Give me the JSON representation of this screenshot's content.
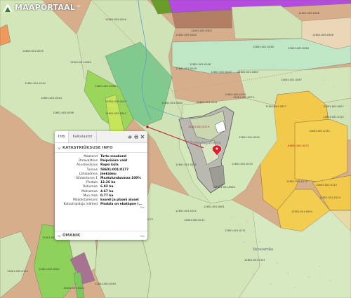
{
  "app": {
    "title": "MAAPORTAAL",
    "title_suffix": "EE"
  },
  "map": {
    "place_names": {
      "village_1": "Värske-Augumetsa",
      "village_2": "Kebasemäe"
    },
    "selected_parcel_label": "58601:001:0177",
    "parcel_labels": [
      "12601:005:0240",
      "12601:005:0286",
      "12601:005:0302",
      "12601:005:0283",
      "12601:005:0306",
      "12601:005:0284",
      "12601:001:0246",
      "12601:001:0245",
      "12601:001:0282",
      "12601:001:0140",
      "12601:001:0248",
      "12601:001:0249",
      "12601:001:0247",
      "12601:001:0080",
      "12601:001:0287",
      "12601:001:0288",
      "12601:001:0244",
      "12601:005:0243",
      "12601:005:0298",
      "12601:005:0242",
      "12601:005:0253",
      "12601:001:0079",
      "12601:001:0260",
      "12601:001:0141",
      "12601:001:0027",
      "12601:001:0057",
      "12601:001:0112",
      "12601:001:0132",
      "12601:001:0045",
      "12601:001:0125",
      "12601:001:0162",
      "12601:001:0170",
      "12601:001:0113",
      "12601:001:0124",
      "12601:001:0050",
      "12601:001:0060",
      "12601:001:0081",
      "12601:001:0102",
      "12601:005:0211",
      "12601:005:0275",
      "12601:001:0131",
      "12601:001:0131",
      "12601:005:0215",
      "12601:005:0282",
      "12601:005:0110",
      "12601:005:0240",
      "12601:005:0214"
    ],
    "highlight_labels": [
      "44601:001:0073",
      "12601:001:0174"
    ]
  },
  "popup": {
    "tabs": [
      "Info",
      "Kalkulaator"
    ],
    "section_title": "KATASTRIÜKSUSE INFO",
    "fields": [
      {
        "key": "Maakond",
        "value": "Tartu maakond"
      },
      {
        "key": "Omavalitsus",
        "value": "Peipsiääre vald"
      },
      {
        "key": "Asustusüksus",
        "value": "Ropsi küla"
      },
      {
        "key": "Tunnus",
        "value": "58601:001:0177"
      },
      {
        "key": "Lähiaadress",
        "value": "Jõekäänu"
      },
      {
        "key": "Sihtotstarve 1",
        "value": "Maatulundusmaa 100%"
      },
      {
        "key": "Pindala",
        "value": "12.26 ha"
      },
      {
        "key": "Rohumaa",
        "value": "6.82 ha"
      },
      {
        "key": "Metsamaa",
        "value": "4.67 ha"
      },
      {
        "key": "Muu maa",
        "value": "0.77 ha"
      },
      {
        "key": "Mõõdistamisviis",
        "value": "kaardi ja plaani alusel"
      },
      {
        "key": "Katastripidaja märked",
        "value": "Pindala on ebatäpne (..."
      }
    ],
    "section_page_label": "Pos",
    "owner_section_title": "OMANIK",
    "owner_page_label": "Pos"
  },
  "colors": {
    "map_base": "#d7b08f",
    "popup_pointer": "#c8102e",
    "selected_marker": "#d81f2a"
  }
}
